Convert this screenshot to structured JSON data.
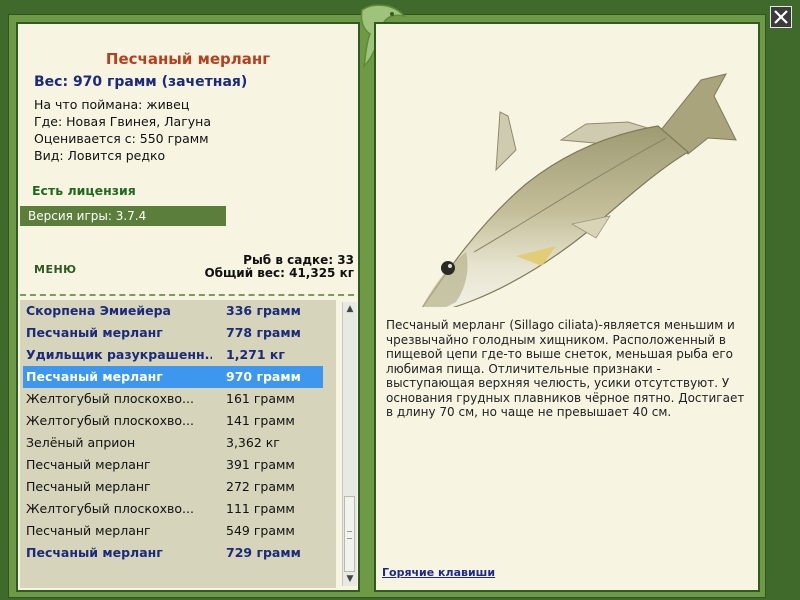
{
  "fish_info": {
    "title": "Песчаный мерланг",
    "weight": "Вес: 970 грамм (зачетная)",
    "bait": "На что поймана: живец",
    "location": "Где: Новая Гвинея, Лагуна",
    "valued_from": "Оценивается с: 550 грамм",
    "rarity": "Вид: Ловится редко"
  },
  "license_text": "Есть лицензия",
  "game_version": "Версия игры: 3.7.4",
  "menu_label": "МЕНЮ",
  "cage": {
    "fish_count": "Рыб в садке: 33",
    "total_weight": "Общий вес: 41,325 кг"
  },
  "catch_list": [
    {
      "name": "Скорпена Эмиейера",
      "weight": "336 грамм"
    },
    {
      "name": "Песчаный мерланг",
      "weight": "778 грамм"
    },
    {
      "name": "Удильщик разукрашенн...",
      "weight": "1,271 кг"
    },
    {
      "name": "Песчаный мерланг",
      "weight": "970 грамм"
    },
    {
      "name": "Желтогубый плоскохво...",
      "weight": "161 грамм"
    },
    {
      "name": "Желтогубый плоскохво...",
      "weight": "141 грамм"
    },
    {
      "name": "Зелёный априон",
      "weight": "3,362 кг"
    },
    {
      "name": "Песчаный мерланг",
      "weight": "391 грамм"
    },
    {
      "name": "Песчаный мерланг",
      "weight": "272 грамм"
    },
    {
      "name": "Желтогубый плоскохво...",
      "weight": "111 грамм"
    },
    {
      "name": "Песчаный мерланг",
      "weight": "549 грамм"
    },
    {
      "name": "Песчаный мерланг",
      "weight": "729 грамм"
    }
  ],
  "description": "Песчаный мерланг (Sillago ciliata)-является меньшим и чрезвычайно голодным хищником. Расположенный в пищевой цепи где-то выше снеток, меньшая рыба его любимая пища. Отличительные признаки - выступающая верхняя челюсть, усики отсутствуют. У основания грудных плавников чёрное пятно. Достигает в длину 70 см, но чаще не превышает 40 см.",
  "hotkeys_link": "Горячие клавиши",
  "colors": {
    "background": "#3f6a2c",
    "frame": "#6e9a45",
    "panel": "#f7f4e2",
    "selected_row": "#3d97ee",
    "title": "#b5401e",
    "highlight_text": "#1b2a7a"
  }
}
